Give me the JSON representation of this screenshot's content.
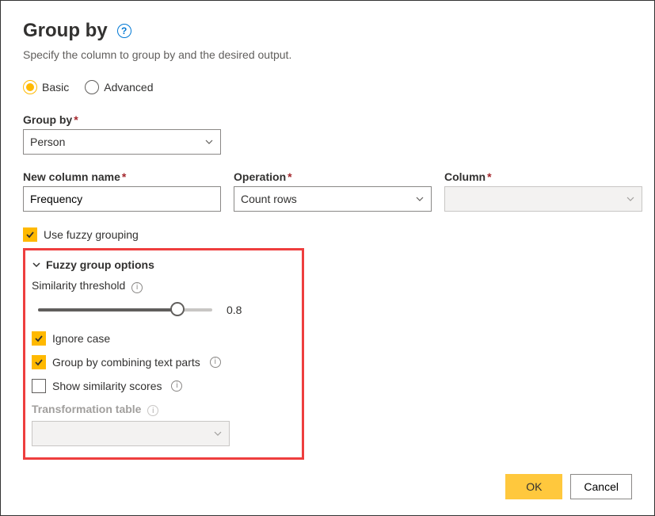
{
  "header": {
    "title": "Group by",
    "subtitle": "Specify the column to group by and the desired output."
  },
  "mode": {
    "basic_label": "Basic",
    "advanced_label": "Advanced",
    "selected": "basic"
  },
  "group_by_field": {
    "label": "Group by",
    "value": "Person"
  },
  "aggregation": {
    "new_col_label": "New column name",
    "new_col_value": "Frequency",
    "operation_label": "Operation",
    "operation_value": "Count rows",
    "column_label": "Column",
    "column_value": ""
  },
  "fuzzy": {
    "use_fuzzy_label": "Use fuzzy grouping",
    "use_fuzzy_checked": true,
    "options_title": "Fuzzy group options",
    "similarity_label": "Similarity threshold",
    "similarity_value": "0.8",
    "ignore_case_label": "Ignore case",
    "ignore_case_checked": true,
    "combine_parts_label": "Group by combining text parts",
    "combine_parts_checked": true,
    "show_scores_label": "Show similarity scores",
    "show_scores_checked": false,
    "transform_table_label": "Transformation table",
    "transform_table_value": ""
  },
  "buttons": {
    "ok": "OK",
    "cancel": "Cancel"
  }
}
